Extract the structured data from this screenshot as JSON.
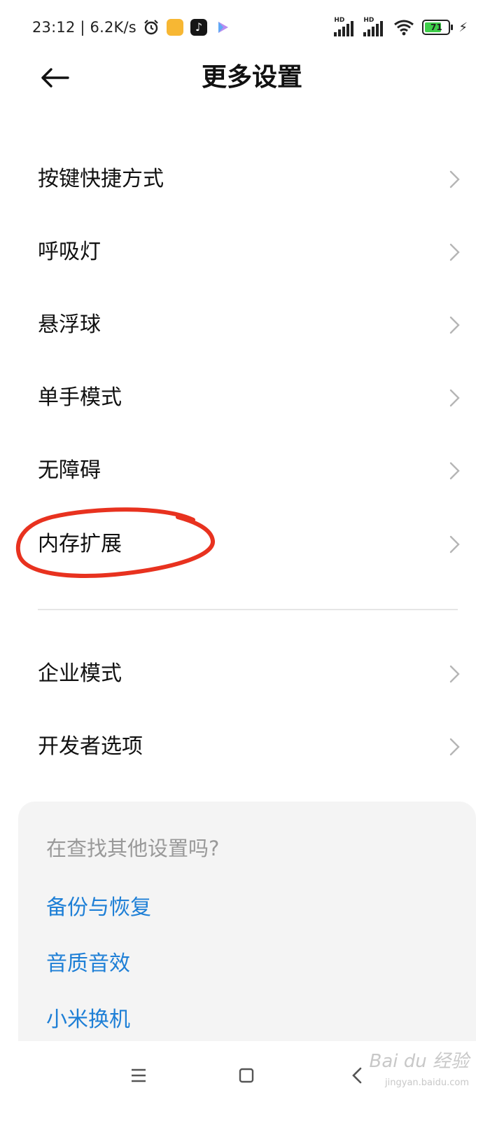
{
  "status_bar": {
    "time_speed": "23:12 | 6.2K/s",
    "battery_level": "71",
    "battery_percent": 71,
    "icons": [
      "alarm-icon",
      "notes-app-icon",
      "tiktok-app-icon",
      "play-app-icon",
      "hd-signal-icon",
      "hd-signal-icon",
      "wifi-icon",
      "battery-icon",
      "charging-icon"
    ]
  },
  "header": {
    "title": "更多设置"
  },
  "settings": {
    "items": [
      {
        "label": "按键快捷方式"
      },
      {
        "label": "呼吸灯"
      },
      {
        "label": "悬浮球"
      },
      {
        "label": "单手模式"
      },
      {
        "label": "无障碍"
      },
      {
        "label": "内存扩展"
      },
      {
        "label": "企业模式"
      },
      {
        "label": "开发者选项"
      }
    ]
  },
  "suggestions": {
    "title": "在查找其他设置吗?",
    "links": [
      {
        "label": "备份与恢复"
      },
      {
        "label": "音质音效"
      },
      {
        "label": "小米换机"
      }
    ]
  },
  "watermark": {
    "brand": "Bai du 经验",
    "site": "jingyan.baidu.com"
  },
  "colors": {
    "link": "#1e7fd6",
    "annotation": "#e8321f",
    "card_bg": "#f4f4f4",
    "muted": "#999999",
    "battery_fill": "#3fcf4a"
  }
}
